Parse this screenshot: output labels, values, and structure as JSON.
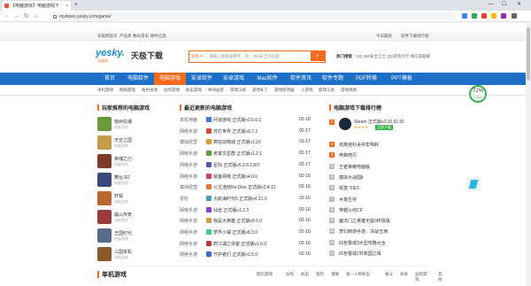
{
  "browser": {
    "tab_title": "【电脑游戏】电脑游戏下",
    "tab_close": "×",
    "new_tab": "+",
    "url": "mydown.yesky.com/game/",
    "back": "←",
    "forward": "→",
    "reload": "↻",
    "home": "⌂",
    "window_controls": {
      "min": "—",
      "max": "☐",
      "close": "✕"
    }
  },
  "sitetop": {
    "left_links": [
      "天极网首页",
      "产品库",
      "数码资讯",
      "硬件信息"
    ],
    "right_links": [
      "今日最新",
      "软件下载排行榜"
    ]
  },
  "header": {
    "logo": "yesky.",
    "logo_sub": "天极网",
    "site_name": "天极下载",
    "search_select": "软件 ▾",
    "search_placeholder": "请输入搜索关键字，如：360安全浏览器",
    "search_button": "⌕",
    "hot_label": "热门搜索",
    "hot_terms": [
      "QQ",
      "360安全卫士",
      "QQ游戏大厅",
      "微信电脑版"
    ]
  },
  "mainnav": {
    "items": [
      "首页",
      "电脑软件",
      "电脑游戏",
      "安卓软件",
      "安卓游戏",
      "Mac软件",
      "软件资讯",
      "软件专题",
      "PDF转换",
      "PPT模板"
    ],
    "active_index": 2
  },
  "subnav": {
    "items": [
      "单机游戏",
      "网络游戏",
      "角色扮演",
      "动作游戏",
      "射击游戏",
      "休闲益智",
      "游戏工具",
      "游戏补丁",
      "游戏修改器",
      "小游戏",
      "游戏工具",
      "游戏视频"
    ]
  },
  "left_section": {
    "title": "玩家推荐的电脑游戏",
    "items": [
      {
        "name": "植树狂潮",
        "sub": "电脑游戏",
        "color": "#6a9a3a"
      },
      {
        "name": "天空之国",
        "sub": "电脑游戏",
        "color": "#c59c4a"
      },
      {
        "name": "英魂之刃",
        "sub": "电脑游戏",
        "color": "#7b3a2a"
      },
      {
        "name": "舞台决2",
        "sub": "电脑游戏",
        "color": "#3a4a7b"
      },
      {
        "name": "轩辕",
        "sub": "电脑游戏",
        "color": "#b8682c"
      },
      {
        "name": "最山传奇",
        "sub": "电脑游戏",
        "color": "#9a3a3a"
      },
      {
        "name": "王国时代",
        "sub": "电脑游戏",
        "color": "#5a6a8a"
      },
      {
        "name": "三国单机",
        "sub": "电脑游戏",
        "color": "#8a5a2a"
      }
    ]
  },
  "middle_section": {
    "title": "最近更新的电脑游戏",
    "rows": [
      {
        "cat": "单机电脑",
        "title": "问道游戏 正式版v3.6.6.1",
        "date": "02-18",
        "color": "#3c7bd6"
      },
      {
        "cat": "网络手游",
        "title": "苏打世界 正式版v9.7.2",
        "date": "02-17",
        "color": "#d64a3c"
      },
      {
        "cat": "模拟经营",
        "title": "疯狂动物城 正式版v1.20",
        "date": "02-17",
        "color": "#e0a030"
      },
      {
        "cat": "网络手游",
        "title": "老掌文星群 正式版v1.2.1",
        "date": "02-17",
        "color": "#5aa03c"
      },
      {
        "cat": "网络手游",
        "title": "星际 正式版v5.3.6.1367",
        "date": "02-17",
        "color": "#4a5ab8"
      },
      {
        "cat": "网络手游",
        "title": "装备网络 正式版v4.0.6",
        "date": "02-16",
        "color": "#d63c8a"
      },
      {
        "cat": "模拟经营",
        "title": "公主连结Re:Dive 正式版v3.4.12",
        "date": "02-16",
        "color": "#e07a30"
      },
      {
        "cat": "冒险",
        "title": "大航海时代5 正式版v4.21.0",
        "date": "02-16",
        "color": "#3ca0b8"
      },
      {
        "cat": "网络手游",
        "title": "仙途 正式版v1.2.3",
        "date": "02-16",
        "color": "#8a3cd6"
      },
      {
        "cat": "网络手游",
        "title": "我是大英雄 正式版v9.0.0",
        "date": "02-16",
        "color": "#d6a03c"
      },
      {
        "cat": "网络手游",
        "title": "梦界小镇 正式版v8.3.0",
        "date": "02-16",
        "color": "#3cd67a"
      },
      {
        "cat": "网络手游",
        "title": "蔚江湖之侠客 正式版v1.0.0",
        "date": "02-16",
        "color": "#b83c3c"
      },
      {
        "cat": "网络手游",
        "title": "守护者们 正式版v1.5.0",
        "date": "02-16",
        "color": "#3c6ad6"
      }
    ]
  },
  "right_section": {
    "title": "电脑游戏下载排行榜",
    "top_item": {
      "name": "Steam 正式版v2.10.91.91",
      "stars": "★★★★",
      "button": "立即下载"
    },
    "rows": [
      "逃离塔科夫中年陶醉",
      "奔跑吧兄",
      "王者荣耀电脑版",
      "模拟大战国Ⅱ",
      "铁盒飞车5",
      "木筏生存",
      "穿越火线CF",
      "魔法门之英雄无敌3终极版",
      "梦幻西游手游：决战玉渊",
      "红色警戒3大型攻略大全",
      "红色警戒2共和国之辉"
    ]
  },
  "bottom_section": {
    "title": "单机游戏",
    "tabs": [
      "网页游戏",
      "动作",
      "射击",
      "冒险",
      "策略",
      "第一人称射击",
      "格斗",
      "体育",
      "益智游戏",
      "其他"
    ]
  },
  "gauge": {
    "value": "72%",
    "label": "0.3k/s"
  }
}
